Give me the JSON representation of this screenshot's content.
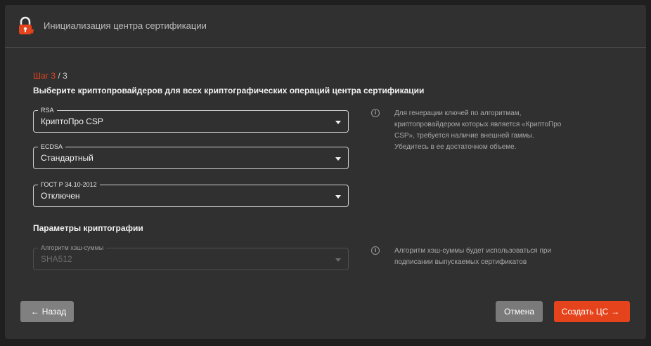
{
  "header": {
    "title": "Инициализация центра сертификации"
  },
  "step": {
    "current": "Шаг 3",
    "rest": " / 3"
  },
  "heading": "Выберите криптопровайдеров для всех криптографических операций центра сертификации",
  "fields": {
    "rsa": {
      "label": "RSA",
      "value": "КриптоПро CSP"
    },
    "ecdsa": {
      "label": "ECDSA",
      "value": "Стандартный"
    },
    "gost": {
      "label": "ГОСТ Р 34.10-2012",
      "value": "Отключен"
    }
  },
  "info1": "Для генерации ключей по алгоритмам, криптопровайдером которых является «КриптоПро CSP», требуется наличие внешней гаммы. Убедитесь в ее достаточном объеме.",
  "crypto_params": {
    "title": "Параметры криптографии",
    "hash": {
      "label": "Алгоритм хэш-суммы",
      "value": "SHA512"
    },
    "info": "Алгоритм хэш-суммы будет использоваться при подписании выпускаемых сертификатов"
  },
  "buttons": {
    "back": "Назад",
    "cancel": "Отмена",
    "create": "Создать ЦС"
  },
  "icons": {
    "back": "arrow-left-icon",
    "create": "arrow-right-icon",
    "info": "info-icon",
    "logo": "lock-logo-icon"
  },
  "colors": {
    "accent": "#e5431b",
    "background": "#303030"
  }
}
